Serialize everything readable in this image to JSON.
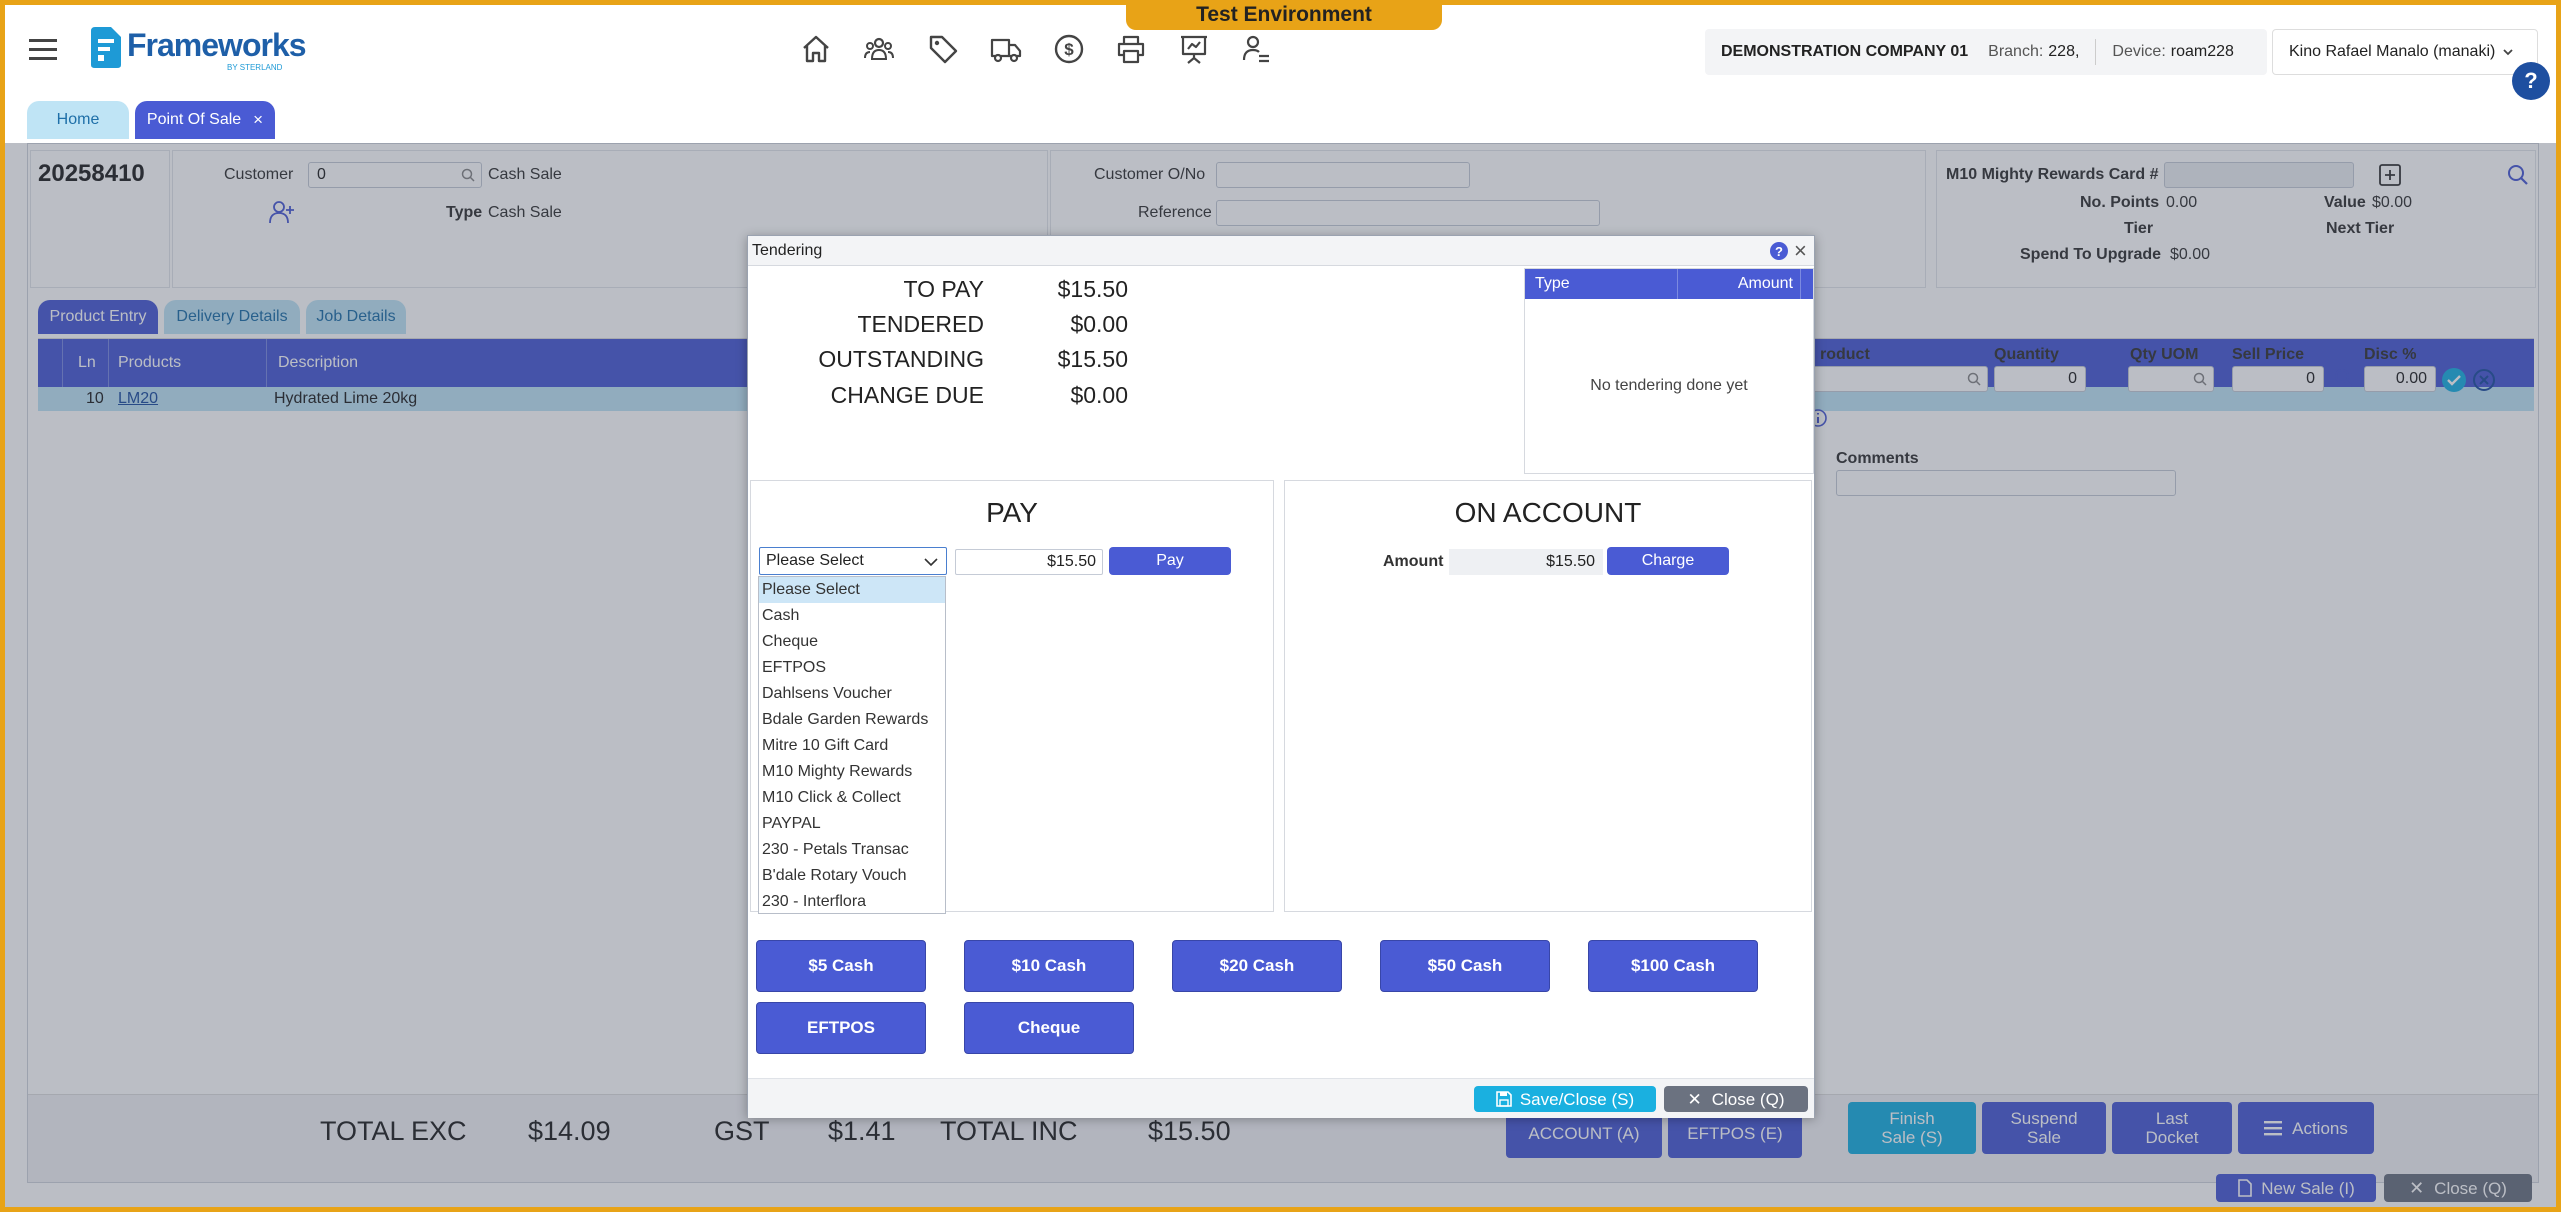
{
  "header": {
    "logo_text": "Frameworks",
    "logo_sub": "BY STERLAND",
    "env_badge": "Test Environment",
    "company": "DEMONSTRATION COMPANY 01",
    "branch_label": "Branch:",
    "branch_value": "228,",
    "device_label": "Device:",
    "device_value": "roam228",
    "user": "Kino Rafael Manalo (manaki)",
    "help": "?",
    "nav_icons": [
      "home-icon",
      "people-icon",
      "tag-icon",
      "truck-icon",
      "dollar-icon",
      "printer-icon",
      "presentation-icon",
      "user-settings-icon"
    ]
  },
  "tabs": [
    {
      "label": "Home"
    },
    {
      "label": "Point Of Sale",
      "close": "×"
    }
  ],
  "sale": {
    "number": "20258410",
    "customer_label": "Customer",
    "customer_value": "0",
    "customer_name": "Cash Sale",
    "type_label": "Type",
    "type_value": "Cash Sale",
    "customer_on_label": "Customer O/No",
    "reference_label": "Reference"
  },
  "rewards": {
    "card_label": "M10 Mighty Rewards Card #",
    "points_label": "No. Points",
    "points_value": "0.00",
    "value_label": "Value",
    "value_value": "$0.00",
    "tier_label": "Tier",
    "next_tier_label": "Next Tier",
    "spend_label": "Spend To Upgrade",
    "spend_value": "$0.00"
  },
  "subtabs": [
    "Product Entry",
    "Delivery Details",
    "Job Details"
  ],
  "grid": {
    "headers": [
      "Ln",
      "Products",
      "Description"
    ],
    "rows": [
      {
        "ln": "10",
        "product": "LM20",
        "description": "Hydrated Lime 20kg"
      }
    ]
  },
  "entry": {
    "product_label": "roduct",
    "quantity_label": "Quantity",
    "quantity_value": "0",
    "qty_uom_label": "Qty UOM",
    "sell_price_label": "Sell Price",
    "sell_price_value": "0",
    "disc_label": "Disc %",
    "disc_value": "0.00",
    "comments_label": "Comments"
  },
  "totals": {
    "exc_label": "TOTAL EXC",
    "exc_value": "$14.09",
    "gst_label": "GST",
    "gst_value": "$1.41",
    "inc_label": "TOTAL INC",
    "inc_value": "$15.50"
  },
  "footer_buttons": {
    "account": "ACCOUNT (A)",
    "eftpos": "EFTPOS (E)",
    "finish": "Finish Sale (S)",
    "suspend": "Suspend Sale",
    "last_docket": "Last Docket",
    "actions": "Actions",
    "new_sale": "New Sale (I)",
    "close": "Close (Q)"
  },
  "modal": {
    "title": "Tendering",
    "help": "?",
    "close": "×",
    "summary": [
      {
        "label": "TO PAY",
        "value": "$15.50"
      },
      {
        "label": "TENDERED",
        "value": "$0.00"
      },
      {
        "label": "OUTSTANDING",
        "value": "$15.50"
      },
      {
        "label": "CHANGE DUE",
        "value": "$0.00"
      }
    ],
    "tender_table": {
      "headers": [
        "Type",
        "Amount"
      ],
      "empty_text": "No tendering done yet"
    },
    "pay": {
      "title": "PAY",
      "select_value": "Please Select",
      "amount": "$15.50",
      "button": "Pay",
      "options": [
        "Please Select",
        "Cash",
        "Cheque",
        "EFTPOS",
        "Dahlsens Voucher",
        "Bdale Garden Rewards",
        "Mitre 10 Gift Card",
        "M10 Mighty Rewards",
        "M10 Click & Collect",
        "PAYPAL",
        "230 - Petals Transac",
        "B'dale Rotary Vouch",
        "230 - Interflora"
      ]
    },
    "on_account": {
      "title": "ON ACCOUNT",
      "amount_label": "Amount",
      "amount_value": "$15.50",
      "button": "Charge"
    },
    "quick_buttons": [
      "$5 Cash",
      "$10 Cash",
      "$20 Cash",
      "$50 Cash",
      "$100 Cash",
      "EFTPOS",
      "Cheque"
    ],
    "save_close": "Save/Close (S)",
    "close_btn": "Close (Q)"
  },
  "colors": {
    "accent": "#4a5bd4",
    "env_badge": "#e8a317",
    "tab_active": "#4a5bd4",
    "tab_inactive": "#bfe4f5",
    "save_button": "#1ab0e0",
    "close_button": "#6b7280"
  }
}
